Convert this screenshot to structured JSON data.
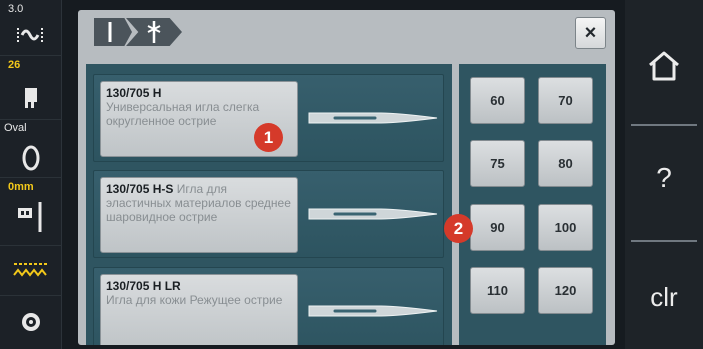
{
  "status": {
    "stitch_width": "3.0",
    "stitch_number": "26",
    "foot_label": "Oval",
    "needle_position": "0mm"
  },
  "header": {
    "tabs": [
      {
        "icon": "needle-icon",
        "label": "Needle"
      },
      {
        "icon": "presser-foot-icon",
        "label": "Presser foot"
      }
    ],
    "close_label": "×"
  },
  "needles": [
    {
      "code": "130/705 H",
      "description": "Универсальная игла слегка округленное острие"
    },
    {
      "code": "130/705 H-S",
      "description": "Игла для эластичных материалов среднее шаровидное острие"
    },
    {
      "code": "130/705 H LR",
      "description": "Игла для кожи Режущее острие"
    }
  ],
  "sizes": [
    "60",
    "70",
    "75",
    "80",
    "90",
    "100",
    "110",
    "120"
  ],
  "badges": [
    "1",
    "2"
  ],
  "nav": {
    "home": "home-icon",
    "help_label": "?",
    "clear_label": "clr"
  },
  "colors": {
    "accent_yellow": "#f2c81a",
    "badge_red": "#d53a2a",
    "panel_teal": "#2f5561",
    "panel_grey": "#b7bcc0"
  }
}
